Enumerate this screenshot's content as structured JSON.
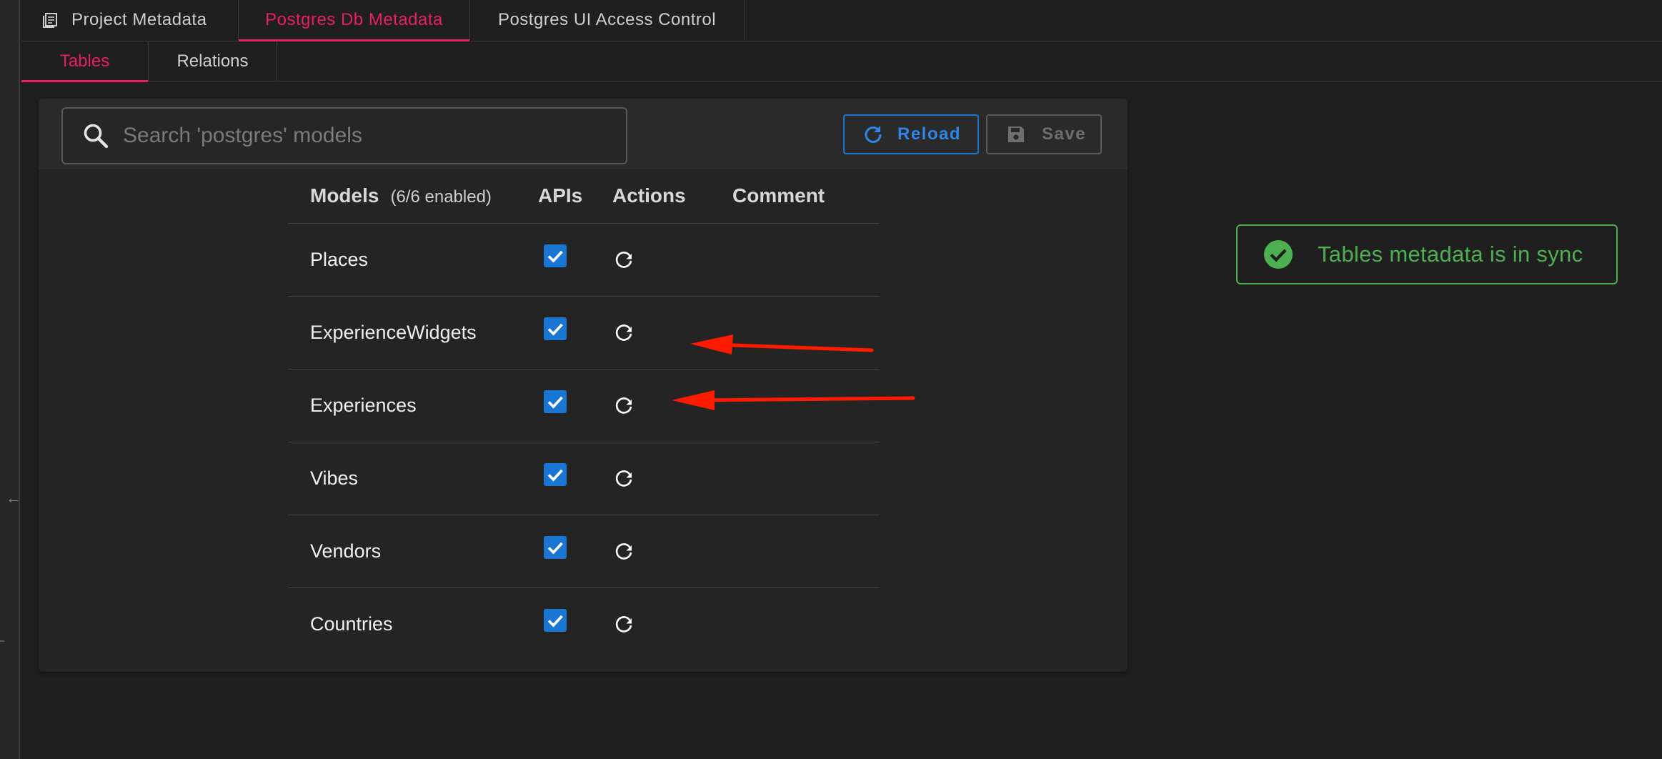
{
  "tabs": [
    {
      "label": "Project Metadata",
      "active": false
    },
    {
      "label": "Postgres Db Metadata",
      "active": true
    },
    {
      "label": "Postgres UI Access Control",
      "active": false
    }
  ],
  "subtabs": [
    {
      "label": "Tables",
      "active": true
    },
    {
      "label": "Relations",
      "active": false
    }
  ],
  "search": {
    "placeholder": "Search 'postgres' models",
    "value": ""
  },
  "toolbar": {
    "reload_label": "Reload",
    "save_label": "Save"
  },
  "table": {
    "headers": {
      "models": "Models",
      "enabled": "(6/6 enabled)",
      "apis": "APIs",
      "actions": "Actions",
      "comment": "Comment"
    },
    "rows": [
      {
        "model": "Places",
        "api_enabled": true,
        "comment": ""
      },
      {
        "model": "ExperienceWidgets",
        "api_enabled": true,
        "comment": ""
      },
      {
        "model": "Experiences",
        "api_enabled": true,
        "comment": ""
      },
      {
        "model": "Vibes",
        "api_enabled": true,
        "comment": ""
      },
      {
        "model": "Vendors",
        "api_enabled": true,
        "comment": ""
      },
      {
        "model": "Countries",
        "api_enabled": true,
        "comment": ""
      }
    ]
  },
  "status": {
    "message": "Tables metadata is in sync",
    "color": "#4caf50"
  },
  "colors": {
    "accent": "#e91e63",
    "primary": "#1976d2",
    "success": "#4caf50",
    "annotation": "#ff1a00"
  },
  "icons": [
    "table-icon",
    "search-icon",
    "refresh-icon",
    "save-icon",
    "checkbox-checked-icon",
    "check-circle-icon",
    "arrow-left-icon"
  ]
}
